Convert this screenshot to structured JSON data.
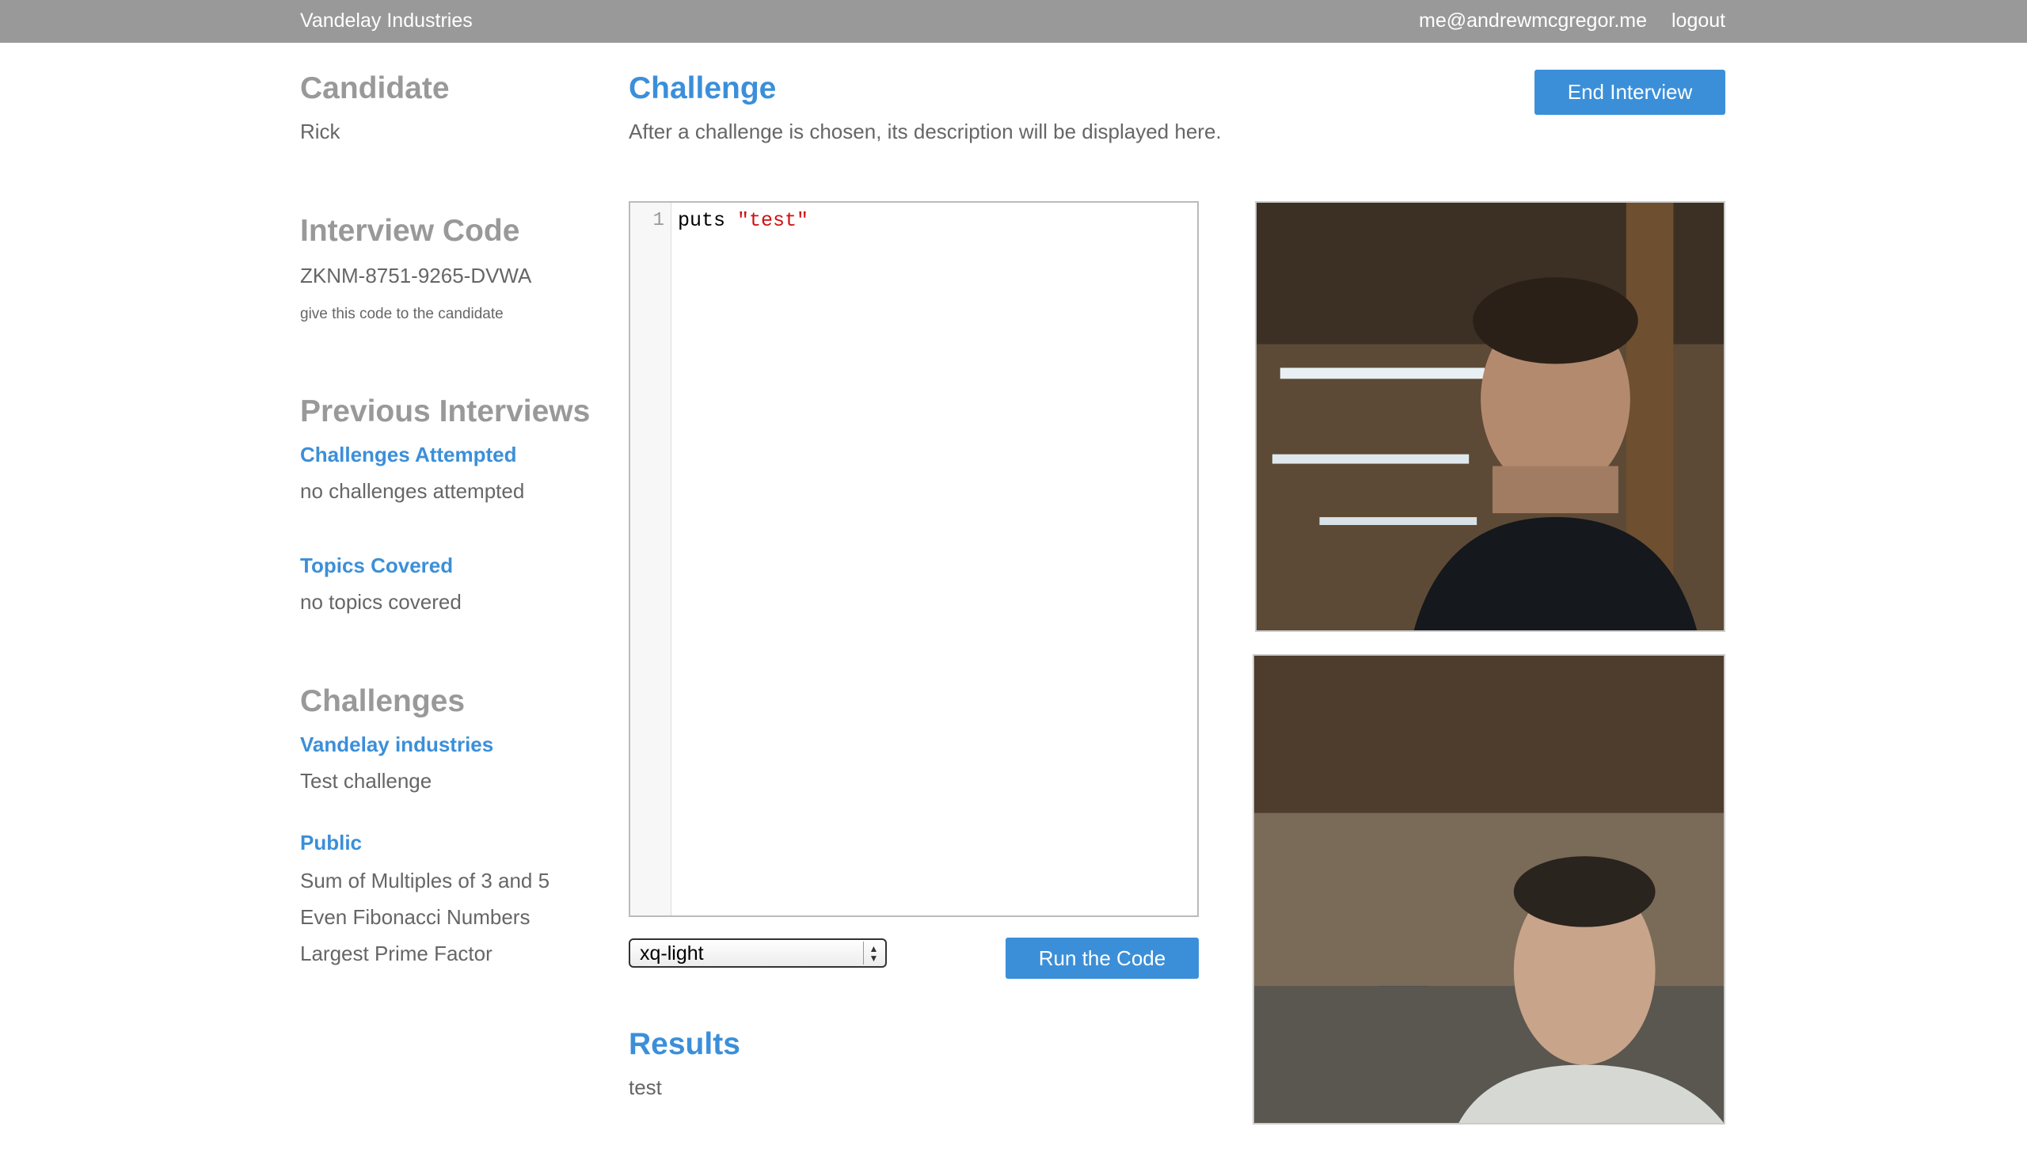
{
  "header": {
    "brand": "Vandelay Industries",
    "user_email": "me@andrewmcgregor.me",
    "logout_label": "logout"
  },
  "sidebar": {
    "candidate_heading": "Candidate",
    "candidate_name": "Rick",
    "interview_code_heading": "Interview Code",
    "interview_code": "ZKNM-8751-9265-DVWA",
    "interview_code_hint": "give this code to the candidate",
    "previous_heading": "Previous Interviews",
    "challenges_attempted_heading": "Challenges Attempted",
    "challenges_attempted_value": "no challenges attempted",
    "topics_covered_heading": "Topics Covered",
    "topics_covered_value": "no topics covered",
    "challenges_heading": "Challenges",
    "groups": [
      {
        "name": "Vandelay industries",
        "items": [
          "Test challenge"
        ]
      },
      {
        "name": "Public",
        "items": [
          "Sum of Multiples of 3 and 5",
          "Even Fibonacci Numbers",
          "Largest Prime Factor"
        ]
      }
    ]
  },
  "main": {
    "challenge_heading": "Challenge",
    "challenge_description": "After a challenge is chosen, its description will be displayed here.",
    "end_interview_label": "End Interview",
    "editor": {
      "line_number": "1",
      "code_keyword": "puts ",
      "code_string": "\"test\""
    },
    "theme_select_value": "xq-light",
    "run_label": "Run the Code",
    "results_heading": "Results",
    "results_output": "test"
  },
  "colors": {
    "accent": "#3b8fd9",
    "topbar": "#999999",
    "heading_gray": "#999999"
  }
}
